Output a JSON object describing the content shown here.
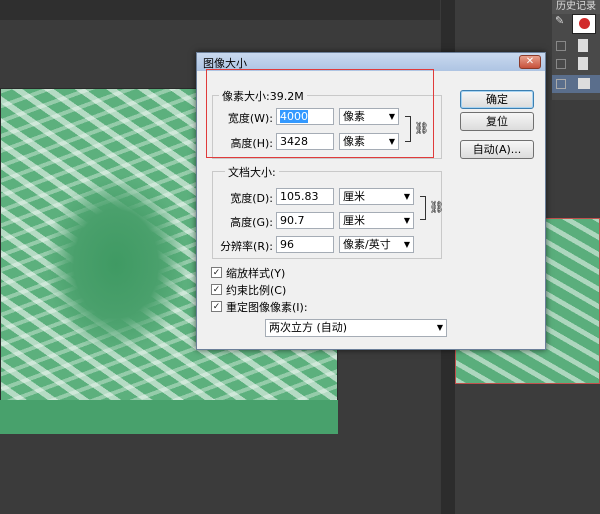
{
  "history": {
    "title": "历史记录",
    "rows": [
      "",
      "",
      "",
      ""
    ]
  },
  "dialog": {
    "title": "图像大小",
    "close_label": "✕",
    "pixel_dimensions": {
      "legend": "像素大小:39.2M",
      "width_label": "宽度(W):",
      "width_value": "4000",
      "width_unit": "像素",
      "height_label": "高度(H):",
      "height_value": "3428",
      "height_unit": "像素"
    },
    "document_size": {
      "legend": "文档大小:",
      "width_label": "宽度(D):",
      "width_value": "105.83",
      "width_unit": "厘米",
      "height_label": "高度(G):",
      "height_value": "90.7",
      "height_unit": "厘米",
      "resolution_label": "分辨率(R):",
      "resolution_value": "96",
      "resolution_unit": "像素/英寸"
    },
    "checkboxes": {
      "scale_styles": "缩放样式(Y)",
      "constrain": "约束比例(C)",
      "resample": "重定图像像素(I):"
    },
    "resample_method": "两次立方 (自动)",
    "buttons": {
      "ok": "确定",
      "reset": "复位",
      "auto": "自动(A)..."
    }
  },
  "colors": {
    "accent_outline": "#e03b3b",
    "canvas_green": "#5cb07d"
  }
}
